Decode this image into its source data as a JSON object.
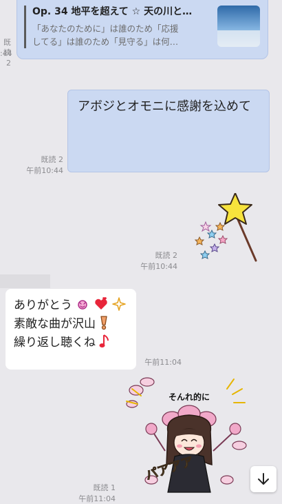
{
  "link_preview": {
    "title": "Op. 34 地平を超えて ☆ 天の川と…",
    "description_lines": [
      "「あなたのために」は誰のため「応援",
      "してる」は誰のため「見守る」は何…"
    ],
    "read_status": "既読 2",
    "time": ":44"
  },
  "outgoing_message": {
    "text": "アボジとオモニに感謝を込めて",
    "read_status": "既読 2",
    "time": "午前10:44"
  },
  "sticker_wand": {
    "read_status": "既読 2",
    "time": "午前10:44"
  },
  "incoming_message": {
    "lines": [
      "ありがとう",
      "素敵な曲が沢山",
      "繰り返し聴くね"
    ],
    "time": "午前11:04"
  },
  "sticker_girl": {
    "caption": "そんれ的に",
    "chant": "パアアア",
    "read_status": "既読 1",
    "time": "午前11:04"
  },
  "colors": {
    "accent_bubble": "#cbd9f2",
    "background": "#e9e8ec"
  },
  "icons": [
    "scroll-down-arrow-icon",
    "star-wand-icon",
    "heart-icon",
    "exclamation-icon",
    "music-note-icon"
  ]
}
